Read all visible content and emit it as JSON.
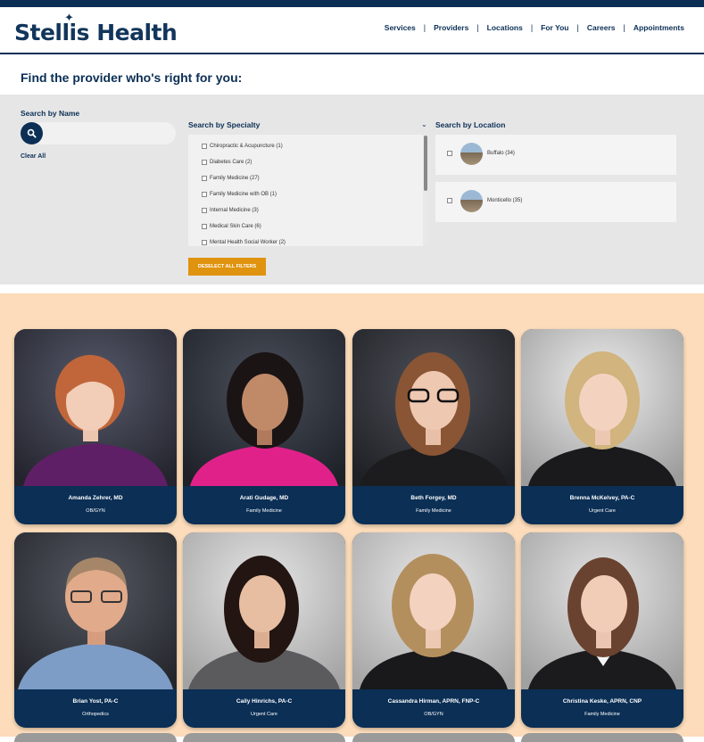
{
  "brand": {
    "name": "Stellis Health",
    "accent": "#0b2f55",
    "orange": "#e0930e",
    "peach": "#fcdcba"
  },
  "nav": {
    "items": [
      "Services",
      "Providers",
      "Locations",
      "For You",
      "Careers",
      "Appointments"
    ],
    "separator": "|"
  },
  "page": {
    "title": "Find the provider who's right for you:"
  },
  "search": {
    "label": "Search by Name",
    "placeholder": "",
    "icon": "search-icon",
    "clear_label": "Clear All"
  },
  "specialty": {
    "label": "Search by Specialty",
    "items": [
      "Chiropractic & Acupuncture (1)",
      "Diabetes Care (2)",
      "Family Medicine (27)",
      "Family Medicine with OB (1)",
      "Internal Medicine (3)",
      "Medical Skin Care (6)",
      "Mental Health Social Worker (2)"
    ]
  },
  "location": {
    "label": "Search by Location",
    "items": [
      "Buffalo (34)",
      "Monticello (35)"
    ]
  },
  "deselect_label": "DESELECT ALL FILTERS",
  "providers": [
    {
      "name": "Amanda Zehrer, MD",
      "specialty": "OB/GYN"
    },
    {
      "name": "Arati Gudage, MD",
      "specialty": "Family Medicine"
    },
    {
      "name": "Beth Forgey, MD",
      "specialty": "Family Medicine"
    },
    {
      "name": "Brenna McKelvey, PA-C",
      "specialty": "Urgent Care"
    },
    {
      "name": "Brian Yost, PA-C",
      "specialty": "Orthopedics"
    },
    {
      "name": "Caily Hinrichs, PA-C",
      "specialty": "Urgent Care"
    },
    {
      "name": "Cassandra Hirman, APRN, FNP-C",
      "specialty": "OB/GYN"
    },
    {
      "name": "Christina Keske, APRN, CNP",
      "specialty": "Family Medicine"
    }
  ]
}
